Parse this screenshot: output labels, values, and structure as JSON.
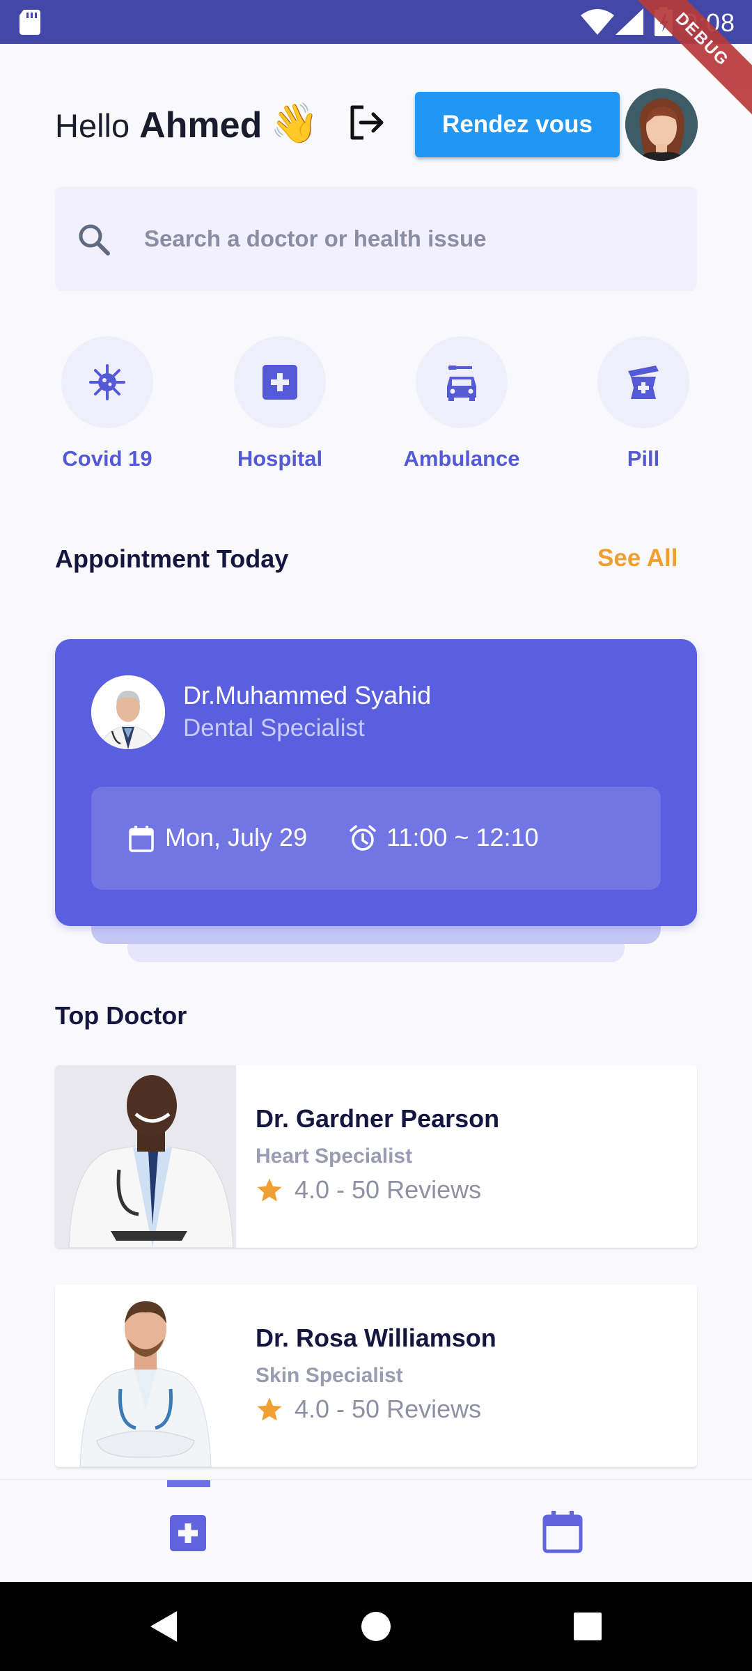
{
  "status_bar": {
    "time": "9:08",
    "debug_label": "DEBUG"
  },
  "header": {
    "greeting": "Hello",
    "user_name": "Ahmed",
    "wave_emoji": "👋",
    "rendezvous_label": "Rendez vous"
  },
  "search": {
    "placeholder": "Search a doctor or health issue"
  },
  "categories": [
    {
      "label": "Covid 19",
      "icon": "virus-icon"
    },
    {
      "label": "Hospital",
      "icon": "hospital-plus-icon"
    },
    {
      "label": "Ambulance",
      "icon": "ambulance-icon"
    },
    {
      "label": "Pill",
      "icon": "pharmacy-icon"
    }
  ],
  "appointments": {
    "title": "Appointment Today",
    "see_all": "See All",
    "card": {
      "doctor_name": "Dr.Muhammed Syahid",
      "specialty": "Dental Specialist",
      "date": "Mon, July 29",
      "time": "11:00 ~ 12:10"
    }
  },
  "top_doctor": {
    "title": "Top Doctor",
    "doctors": [
      {
        "name": "Dr. Gardner Pearson",
        "specialty": "Heart Specialist",
        "rating": "4.0 - 50 Reviews"
      },
      {
        "name": "Dr. Rosa Williamson",
        "specialty": "Skin Specialist",
        "rating": "4.0 - 50 Reviews"
      }
    ]
  },
  "colors": {
    "primary": "#5a5fe0",
    "accent_blue": "#2196f3",
    "see_all": "#f0a030",
    "star": "#f0a030",
    "status_bar": "#4247a8"
  }
}
